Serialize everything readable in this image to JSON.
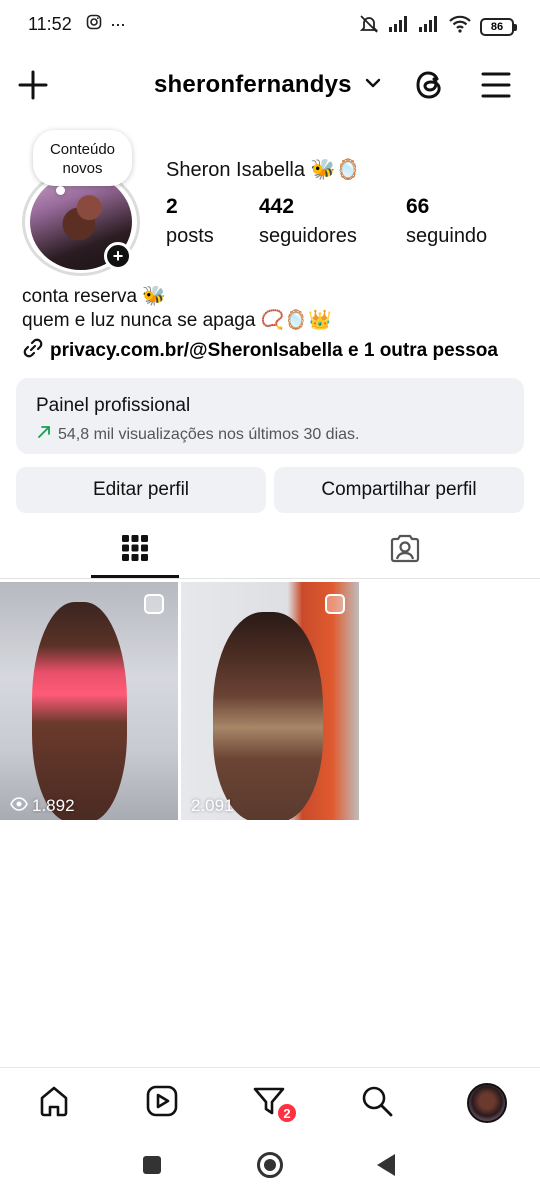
{
  "status_bar": {
    "time": "11:52",
    "dots": "···",
    "battery": "86"
  },
  "header": {
    "username": "sheronfernandys"
  },
  "profile": {
    "note": "Conteúdo novos",
    "display_name": "Sheron Isabella 🐝🪞",
    "posts_count": "2",
    "posts_label": "posts",
    "followers_count": "442",
    "followers_label": "seguidores",
    "following_count": "66",
    "following_label": "seguindo",
    "bio_line1": "conta reserva 🐝",
    "bio_line2": "quem e luz nunca se apaga 📿🪞👑",
    "link": "privacy.com.br/@SheronIsabella e 1 outra pessoa"
  },
  "dashboard": {
    "title": "Painel profissional",
    "subtitle": "54,8 mil visualizações nos últimos 30 dias."
  },
  "buttons": {
    "edit": "Editar perfil",
    "share": "Compartilhar perfil"
  },
  "posts": [
    {
      "views": "1.892"
    },
    {
      "views": "2.091"
    }
  ],
  "bottom_nav": {
    "notifications_badge": "2"
  },
  "colors": {
    "badge": "#ff3040",
    "panel_bg": "#eff1f4",
    "trend_green": "#1a9d52"
  }
}
